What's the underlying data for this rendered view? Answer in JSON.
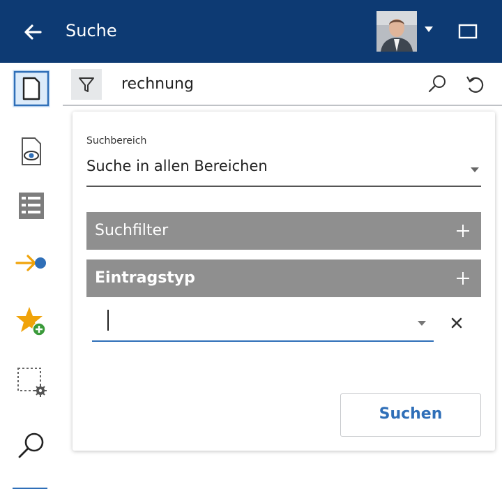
{
  "header": {
    "title": "Suche",
    "back_icon": "arrow-left-icon",
    "avatar_icon": "user-avatar",
    "menu_caret_icon": "caret-down-icon",
    "panel_toggle_icon": "panel-toggle-icon",
    "bg_color": "#0d3a73"
  },
  "sidebar": {
    "items": [
      {
        "name": "document-icon",
        "active": true
      },
      {
        "name": "document-preview-icon",
        "active": false
      },
      {
        "name": "list-view-icon",
        "active": false
      },
      {
        "name": "workflow-arrow-icon",
        "active": false
      },
      {
        "name": "favorite-add-icon",
        "active": false
      },
      {
        "name": "selection-settings-icon",
        "active": false
      },
      {
        "name": "search-icon",
        "active": false
      }
    ],
    "accent_color": "#2f6fb8"
  },
  "searchbar": {
    "filter_icon": "filter-icon",
    "query": "rechnung",
    "search_icon": "search-icon",
    "reset_icon": "reset-icon"
  },
  "search_panel": {
    "area_label": "Suchbereich",
    "area_value": "Suche in allen Bereichen",
    "sections": [
      {
        "label": "Suchfilter",
        "bold": false
      },
      {
        "label": "Eintragstyp",
        "bold": true
      }
    ],
    "entry_type_value": "",
    "submit_label": "Suchen"
  }
}
